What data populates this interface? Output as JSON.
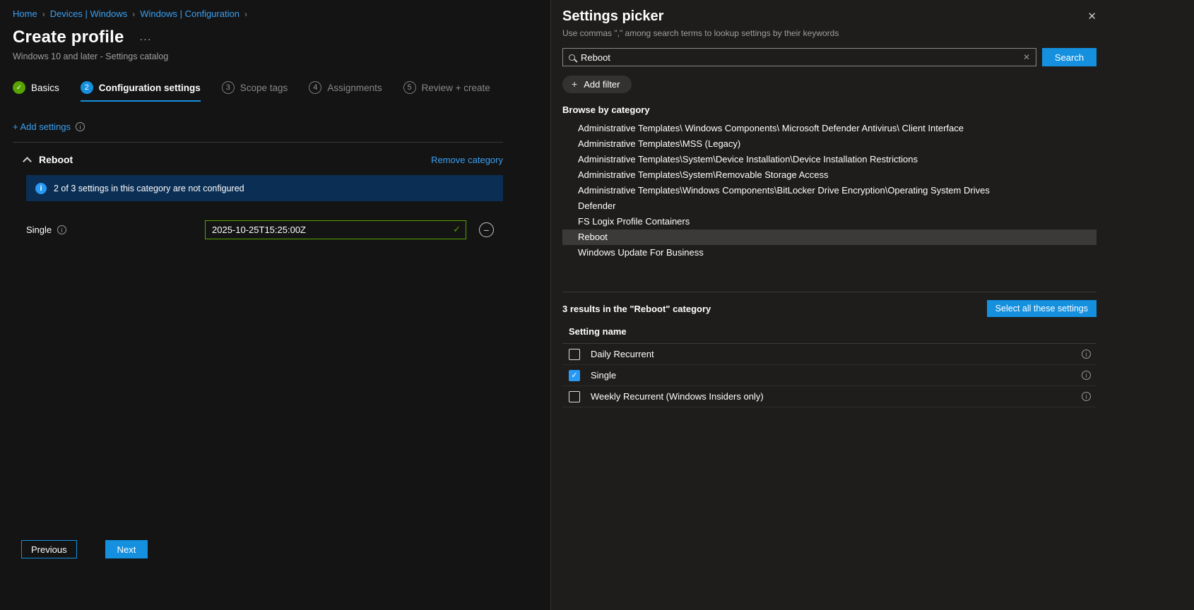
{
  "icons": {
    "breadcrumb_sep": "›",
    "ellipsis": "···",
    "info": "i",
    "check": "✓",
    "minus": "−",
    "close": "✕",
    "clear": "✕",
    "plus": "+"
  },
  "breadcrumb": {
    "items": [
      "Home",
      "Devices | Windows",
      "Windows | Configuration"
    ]
  },
  "page": {
    "title": "Create profile",
    "subtitle": "Windows 10 and later - Settings catalog"
  },
  "steps": [
    {
      "label": "Basics",
      "glyph": "✓",
      "state": "complete"
    },
    {
      "label": "Configuration settings",
      "glyph": "2",
      "state": "active"
    },
    {
      "label": "Scope tags",
      "glyph": "3",
      "state": "inactive"
    },
    {
      "label": "Assignments",
      "glyph": "4",
      "state": "inactive"
    },
    {
      "label": "Review + create",
      "glyph": "5",
      "state": "inactive"
    }
  ],
  "config": {
    "add_settings": "+ Add settings",
    "category": "Reboot",
    "remove_category": "Remove category",
    "info_banner": "2 of 3 settings in this category are not configured",
    "setting_label": "Single",
    "setting_value": "2025-10-25T15:25:00Z"
  },
  "footer": {
    "previous": "Previous",
    "next": "Next"
  },
  "picker": {
    "title": "Settings picker",
    "subtitle": "Use commas \",\" among search terms to lookup settings by their keywords",
    "search_value": "Reboot",
    "search_button": "Search",
    "add_filter": "Add filter",
    "browse_heading": "Browse by category",
    "categories": [
      "Administrative Templates\\ Windows Components\\ Microsoft Defender Antivirus\\ Client Interface",
      "Administrative Templates\\MSS (Legacy)",
      "Administrative Templates\\System\\Device Installation\\Device Installation Restrictions",
      "Administrative Templates\\System\\Removable Storage Access",
      "Administrative Templates\\Windows Components\\BitLocker Drive Encryption\\Operating System Drives",
      "Defender",
      "FS Logix Profile Containers",
      "Reboot",
      "Windows Update For Business"
    ],
    "selected_category": "Reboot",
    "results_text": "3 results in the \"Reboot\" category",
    "select_all_button": "Select all these settings",
    "column_header": "Setting name",
    "settings": [
      {
        "name": "Daily Recurrent",
        "checked": false
      },
      {
        "name": "Single",
        "checked": true
      },
      {
        "name": "Weekly Recurrent (Windows Insiders only)",
        "checked": false
      }
    ]
  },
  "colors": {
    "accent_blue": "#1590df",
    "link_blue": "#3aa0f3",
    "success_green": "#57a300",
    "info_banner_bg": "#0b2e54",
    "selected_row": "#3b3a39"
  }
}
